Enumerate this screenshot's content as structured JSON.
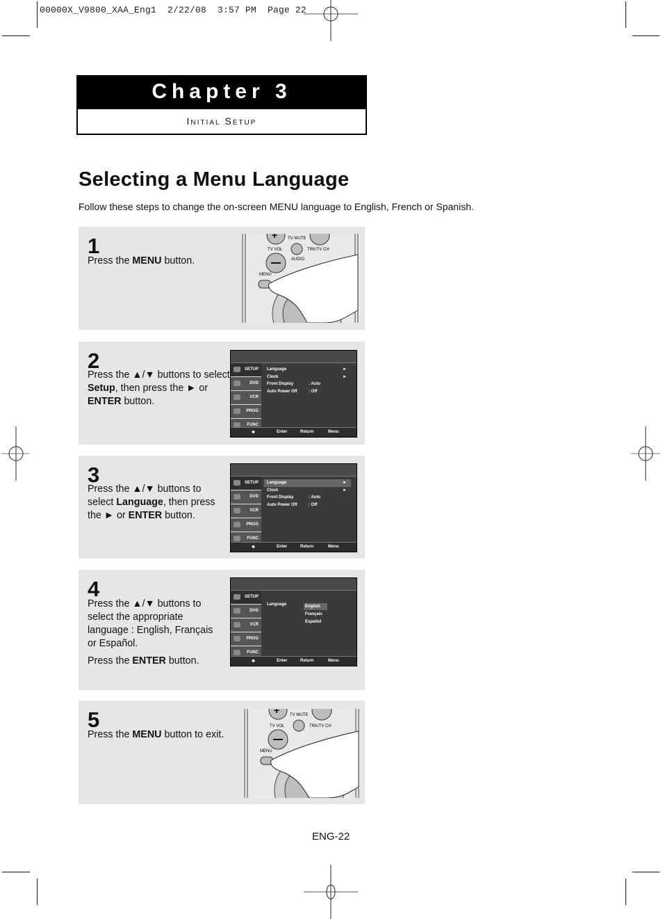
{
  "print_slug": "00000X_V9800_XAA_Eng1  2/22/08  3:57 PM  Page 22",
  "chapter": {
    "title": "Chapter 3",
    "subtitle": "Initial Setup"
  },
  "page_title": "Selecting a Menu Language",
  "intro": "Follow these steps to change the on-screen MENU language to English, French or Spanish.",
  "steps": [
    {
      "number": "1",
      "text_parts": [
        "Press the ",
        "MENU",
        " button."
      ]
    },
    {
      "number": "2",
      "text_parts": [
        "Press the ▲/▼ buttons to select ",
        "Setup",
        ", then press the ► or ",
        "ENTER",
        " button."
      ]
    },
    {
      "number": "3",
      "text_parts": [
        "Press the ▲/▼ buttons to select ",
        "Language",
        ", then press the ► or ",
        "ENTER",
        " button."
      ]
    },
    {
      "number": "4",
      "text_parts": [
        "Press the ▲/▼ buttons to select the appropriate language : English, Français or Español."
      ],
      "text2_parts": [
        "Press the ",
        "ENTER",
        " button."
      ]
    },
    {
      "number": "5",
      "text_parts": [
        "Press the ",
        "MENU",
        " button to exit."
      ]
    }
  ],
  "remote": {
    "labels": {
      "tv_mute": "TV MUTE",
      "tv_vol": "TV VOL",
      "trk": "TRK/TV CH",
      "audio": "AUDIO",
      "menu": "MENU"
    }
  },
  "osd": {
    "sidebar": [
      "SETUP",
      "DVD",
      "VCR",
      "PROG",
      "FUNC"
    ],
    "setup_items": [
      {
        "label": "Language",
        "value": "",
        "arrow": "►"
      },
      {
        "label": "Clock",
        "value": "",
        "arrow": "►"
      },
      {
        "label": "Front Display",
        "value": ": Auto",
        "arrow": ""
      },
      {
        "label": "Auto Power Off",
        "value": ": Off",
        "arrow": ""
      }
    ],
    "language_label": "Language",
    "language_options": [
      "English",
      "Français",
      "Español"
    ],
    "selected_language": "English",
    "footer": {
      "enter": "Enter",
      "return": "Return",
      "menu": "Menu"
    }
  },
  "page_number": "ENG-22"
}
